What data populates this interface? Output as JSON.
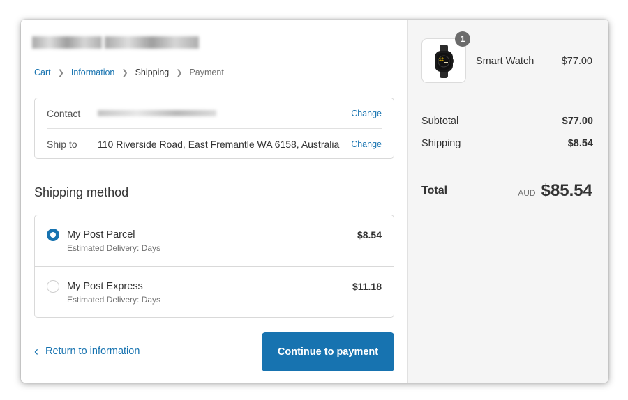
{
  "breadcrumb": {
    "items": [
      {
        "label": "Cart",
        "state": "link"
      },
      {
        "label": "Information",
        "state": "link"
      },
      {
        "label": "Shipping",
        "state": "current"
      },
      {
        "label": "Payment",
        "state": "upcoming"
      }
    ]
  },
  "review": {
    "contact_label": "Contact",
    "ship_to_label": "Ship to",
    "ship_to_value": "110 Riverside Road, East Fremantle WA 6158, Australia",
    "change_label": "Change"
  },
  "shipping": {
    "title": "Shipping method",
    "methods": [
      {
        "name": "My Post Parcel",
        "subtitle": "Estimated Delivery: Days",
        "price": "$8.54",
        "selected": true
      },
      {
        "name": "My Post Express",
        "subtitle": "Estimated Delivery: Days",
        "price": "$11.18",
        "selected": false
      }
    ]
  },
  "actions": {
    "return_label": "Return to information",
    "continue_label": "Continue to payment"
  },
  "order": {
    "product": {
      "name": "Smart Watch",
      "price": "$77.00",
      "quantity": "1",
      "icon": "smartwatch-icon"
    },
    "subtotal_label": "Subtotal",
    "subtotal_value": "$77.00",
    "shipping_label": "Shipping",
    "shipping_value": "$8.54",
    "total_label": "Total",
    "currency": "AUD",
    "total_value": "$85.54"
  },
  "colors": {
    "accent": "#1773b0",
    "sidebar_bg": "#f5f5f5",
    "text": "#333333"
  }
}
